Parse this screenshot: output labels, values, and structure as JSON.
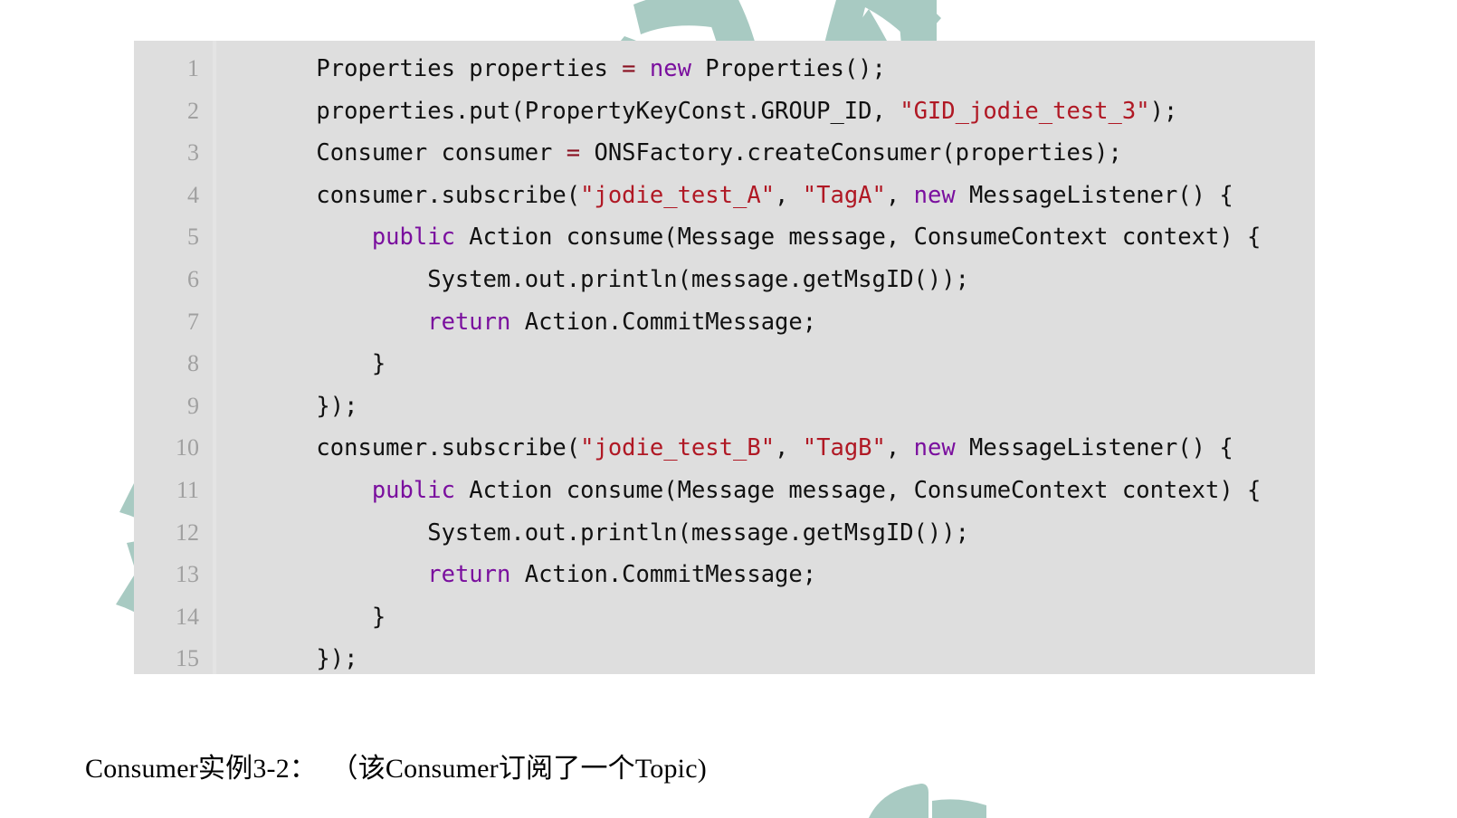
{
  "document": {
    "type": "code-figure",
    "background_color": "#ffffff"
  },
  "code_block": {
    "background_color": "#dedede",
    "gutter_divider_color": "#e4e4e4",
    "line_number_color": "#a0a0a0",
    "language": "java",
    "colors": {
      "plain": "#111111",
      "keyword": "#7a0f9e",
      "string": "#b01824",
      "operator": "#8a1020"
    },
    "lines": [
      {
        "number": "1",
        "tokens": [
          {
            "t": "    Properties properties ",
            "c": "pln"
          },
          {
            "t": "=",
            "c": "op"
          },
          {
            "t": " ",
            "c": "pln"
          },
          {
            "t": "new",
            "c": "kw"
          },
          {
            "t": " Properties();",
            "c": "pln"
          }
        ]
      },
      {
        "number": "2",
        "tokens": [
          {
            "t": "    properties.put(PropertyKeyConst.GROUP_ID, ",
            "c": "pln"
          },
          {
            "t": "\"GID_jodie_test_3\"",
            "c": "str"
          },
          {
            "t": ");",
            "c": "pln"
          }
        ]
      },
      {
        "number": "3",
        "tokens": [
          {
            "t": "    Consumer consumer ",
            "c": "pln"
          },
          {
            "t": "=",
            "c": "op"
          },
          {
            "t": " ONSFactory.createConsumer(properties);",
            "c": "pln"
          }
        ]
      },
      {
        "number": "4",
        "tokens": [
          {
            "t": "    consumer.subscribe(",
            "c": "pln"
          },
          {
            "t": "\"jodie_test_A\"",
            "c": "str"
          },
          {
            "t": ", ",
            "c": "pln"
          },
          {
            "t": "\"TagA\"",
            "c": "str"
          },
          {
            "t": ", ",
            "c": "pln"
          },
          {
            "t": "new",
            "c": "kw"
          },
          {
            "t": " MessageListener() {",
            "c": "pln"
          }
        ]
      },
      {
        "number": "5",
        "tokens": [
          {
            "t": "        ",
            "c": "pln"
          },
          {
            "t": "public",
            "c": "kw"
          },
          {
            "t": " Action consume(Message message, ConsumeContext context) {",
            "c": "pln"
          }
        ]
      },
      {
        "number": "6",
        "tokens": [
          {
            "t": "            System.out.println(message.getMsgID());",
            "c": "pln"
          }
        ]
      },
      {
        "number": "7",
        "tokens": [
          {
            "t": "            ",
            "c": "pln"
          },
          {
            "t": "return",
            "c": "kw"
          },
          {
            "t": " Action.CommitMessage;",
            "c": "pln"
          }
        ]
      },
      {
        "number": "8",
        "tokens": [
          {
            "t": "        }",
            "c": "pln"
          }
        ]
      },
      {
        "number": "9",
        "tokens": [
          {
            "t": "    });",
            "c": "pln"
          }
        ]
      },
      {
        "number": "10",
        "tokens": [
          {
            "t": "    consumer.subscribe(",
            "c": "pln"
          },
          {
            "t": "\"jodie_test_B\"",
            "c": "str"
          },
          {
            "t": ", ",
            "c": "pln"
          },
          {
            "t": "\"TagB\"",
            "c": "str"
          },
          {
            "t": ", ",
            "c": "pln"
          },
          {
            "t": "new",
            "c": "kw"
          },
          {
            "t": " MessageListener() {",
            "c": "pln"
          }
        ]
      },
      {
        "number": "11",
        "tokens": [
          {
            "t": "        ",
            "c": "pln"
          },
          {
            "t": "public",
            "c": "kw"
          },
          {
            "t": " Action consume(Message message, ConsumeContext context) {",
            "c": "pln"
          }
        ]
      },
      {
        "number": "12",
        "tokens": [
          {
            "t": "            System.out.println(message.getMsgID());",
            "c": "pln"
          }
        ]
      },
      {
        "number": "13",
        "tokens": [
          {
            "t": "            ",
            "c": "pln"
          },
          {
            "t": "return",
            "c": "kw"
          },
          {
            "t": " Action.CommitMessage;",
            "c": "pln"
          }
        ]
      },
      {
        "number": "14",
        "tokens": [
          {
            "t": "        }",
            "c": "pln"
          }
        ]
      },
      {
        "number": "15",
        "tokens": [
          {
            "t": "    });",
            "c": "pln"
          }
        ]
      }
    ]
  },
  "caption": {
    "text": "Consumer实例3-2：  （该Consumer订阅了一个Topic)"
  },
  "watermark": {
    "primary_color": "#a8cac2",
    "accent_color": "#eec28f",
    "description": "stylized-u-logo-with-chinese-calligraphy"
  }
}
